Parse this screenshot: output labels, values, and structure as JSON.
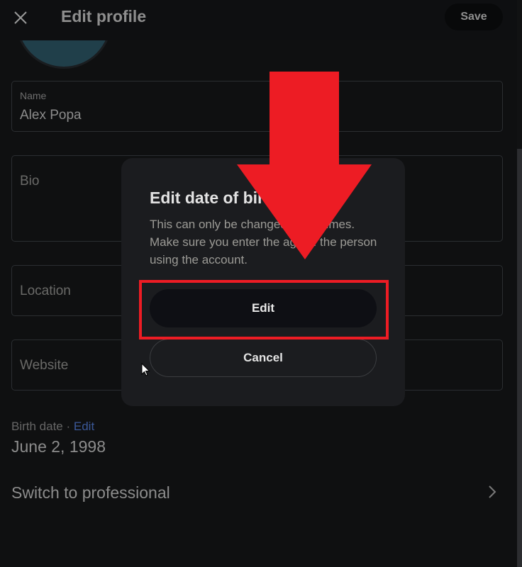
{
  "header": {
    "title": "Edit profile",
    "save_label": "Save",
    "close_icon": "close-icon"
  },
  "form": {
    "name": {
      "label": "Name",
      "value": "Alex Popa"
    },
    "bio": {
      "placeholder": "Bio"
    },
    "location": {
      "placeholder": "Location"
    },
    "website": {
      "placeholder": "Website"
    },
    "birth": {
      "label": "Birth date",
      "separator": " · ",
      "edit_label": "Edit",
      "value": "June 2, 1998"
    },
    "switch_label": "Switch to professional"
  },
  "dialog": {
    "title": "Edit date of birth?",
    "body": "This can only be changed a few times. Make sure you enter the age of the person using the account.",
    "edit_label": "Edit",
    "cancel_label": "Cancel"
  },
  "annotation": {
    "color": "#ED1C24"
  }
}
